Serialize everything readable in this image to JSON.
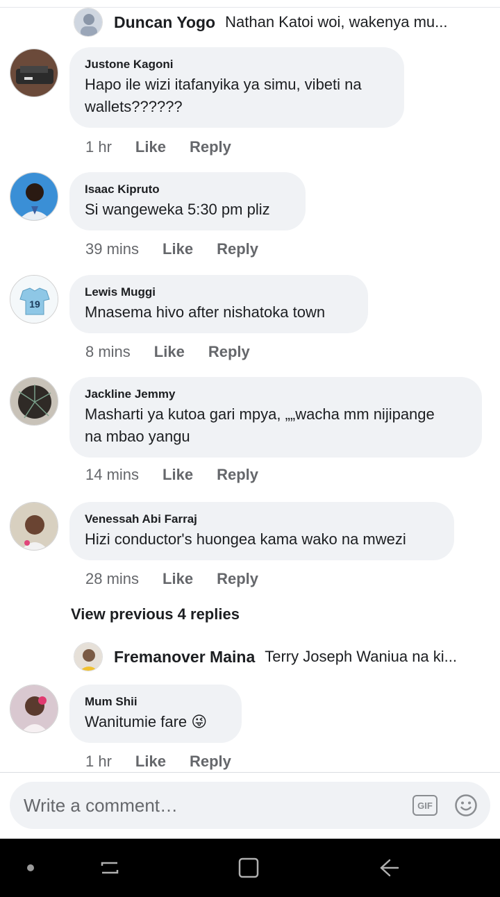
{
  "previews": [
    {
      "name": "Duncan Yogo",
      "text": "Nathan Katoi woi, wakenya mu..."
    },
    {
      "name": "Fremanover Maina",
      "text": "Terry Joseph Waniua na ki..."
    }
  ],
  "comments": [
    {
      "author": "Justone Kagoni",
      "line1": "Hapo ile wizi itafanyika ya simu, vibeti na",
      "line2": "wallets??????",
      "time": "1 hr",
      "like": "Like",
      "reply": "Reply"
    },
    {
      "author": "Isaac Kipruto",
      "line1": "Si wangeweka 5:30 pm pliz",
      "line2": "",
      "time": "39 mins",
      "like": "Like",
      "reply": "Reply"
    },
    {
      "author": "Lewis Muggi",
      "line1": "Mnasema hivo after nishatoka town",
      "line2": "",
      "time": "8 mins",
      "like": "Like",
      "reply": "Reply"
    },
    {
      "author": "Jackline Jemmy",
      "line1": "Masharti ya kutoa gari mpya, „„wacha mm nijipange",
      "line2": "na mbao yangu",
      "time": "14 mins",
      "like": "Like",
      "reply": "Reply"
    },
    {
      "author": "Venessah Abi Farraj",
      "line1": "Hizi conductor's huongea kama wako na mwezi",
      "line2": "",
      "time": "28 mins",
      "like": "Like",
      "reply": "Reply"
    },
    {
      "author": "Mum Shii",
      "line1": "Wanitumie fare 😜",
      "line2": "",
      "time": "1 hr",
      "like": "Like",
      "reply": "Reply"
    }
  ],
  "view_previous": "View previous 4 replies",
  "composer": {
    "placeholder": "Write a comment…",
    "gif_label": "GIF"
  },
  "icons": {
    "gif": "gif-icon",
    "emoji": "emoji-icon",
    "nav_dot": "dot-icon",
    "nav_recents": "recents-icon",
    "nav_home": "home-icon",
    "nav_back": "back-icon"
  },
  "colors": {
    "bubble": "#f0f2f5",
    "meta": "#65676b",
    "text": "#1c1e21",
    "navbar": "#000000"
  }
}
